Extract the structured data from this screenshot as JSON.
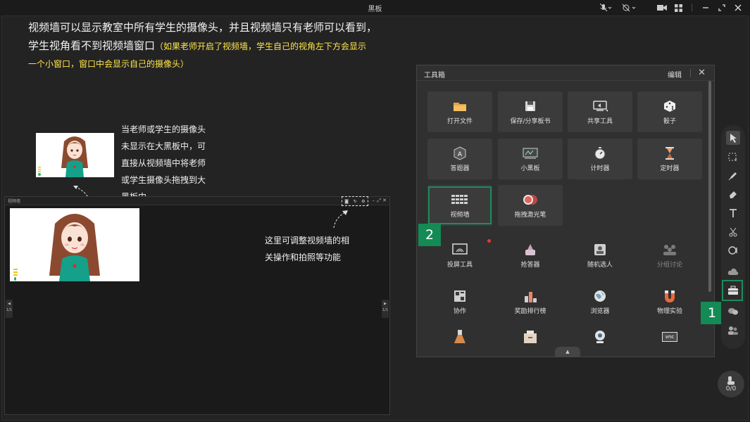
{
  "window": {
    "title": "黑板"
  },
  "intro": {
    "line1": "视频墙可以显示教室中所有学生的摄像头，并且视频墙只有老师可以看到，",
    "line2_white": "学生视角看不到视频墙窗口",
    "line2_yellow": "（如果老师开启了视频墙，学生自己的视角左下方会显示",
    "line3_yellow": "一个小窗口，窗口中会显示自己的摄像头）"
  },
  "captions": {
    "drag_tip": [
      "当老师或学生的摄像头",
      "未显示在大黑板中，可",
      "直接从视频墙中将老师",
      "或学生摄像头拖拽到大",
      "黑板中"
    ],
    "controls_tip": [
      "这里可调整视频墙的相",
      "关操作和拍照等功能"
    ]
  },
  "video_wall": {
    "title": "视频墙",
    "left_pager": "1/1",
    "right_pager": "1/1"
  },
  "toolbox": {
    "title": "工具箱",
    "edit": "编辑",
    "close_glyph": "✕",
    "tools": [
      {
        "label": "打开文件",
        "icon": "folder-icon"
      },
      {
        "label": "保存/分享板书",
        "icon": "save-icon"
      },
      {
        "label": "共享工具",
        "icon": "share-screen-icon"
      },
      {
        "label": "骰子",
        "icon": "dice-icon"
      },
      {
        "label": "答题器",
        "icon": "answer-icon"
      },
      {
        "label": "小黑板",
        "icon": "small-board-icon"
      },
      {
        "label": "计时器",
        "icon": "stopwatch-icon"
      },
      {
        "label": "定时器",
        "icon": "hourglass-icon"
      },
      {
        "label": "视频墙",
        "icon": "video-wall-icon"
      },
      {
        "label": "拖拽激光笔",
        "icon": "laser-pen-icon"
      },
      {
        "label": "投屏工具",
        "icon": "cast-icon"
      },
      {
        "label": "抢答器",
        "icon": "buzzer-icon"
      },
      {
        "label": "随机选人",
        "icon": "random-pick-icon"
      },
      {
        "label": "分组讨论",
        "icon": "group-discuss-icon"
      },
      {
        "label": "协作",
        "icon": "collab-icon"
      },
      {
        "label": "奖励排行榜",
        "icon": "leaderboard-icon"
      },
      {
        "label": "浏览器",
        "icon": "browser-icon"
      },
      {
        "label": "物理实验",
        "icon": "magnet-icon"
      },
      {
        "label": "",
        "icon": "flask-icon"
      },
      {
        "label": "",
        "icon": "archive-icon"
      },
      {
        "label": "",
        "icon": "webcam-icon"
      },
      {
        "label": "",
        "icon": "vnc-icon"
      }
    ],
    "vnc_text": "vnc"
  },
  "steps": {
    "one": "1",
    "two": "2"
  },
  "counter": {
    "value": "0/0"
  },
  "colors": {
    "accent_green": "#1d8b5e",
    "badge_green": "#148a55",
    "note_yellow": "#ffe64a"
  }
}
